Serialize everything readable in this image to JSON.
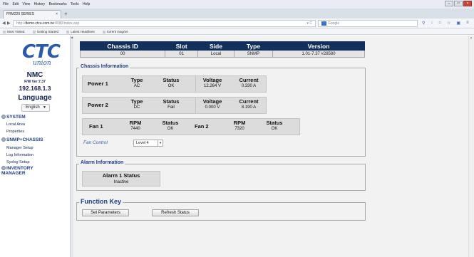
{
  "browser": {
    "menu": [
      "File",
      "Edit",
      "View",
      "History",
      "Bookmarks",
      "Tools",
      "Help"
    ],
    "tab_title": "FRM220 SERIES",
    "tab_close": "×",
    "new_tab": "+",
    "url_host": "demo.ctcu.com.tw",
    "url_path": ":8080/index.asp",
    "url_prefix": "http://",
    "search_placeholder": "Google",
    "bookmarks": [
      "Most Visited",
      "Getting Started",
      "Latest Headlines",
      "torrent magnet"
    ]
  },
  "sidebar": {
    "logo_main": "CTC",
    "logo_sub": "union",
    "product": "NMC",
    "firmware": "F/W Ver:7.37",
    "ip": "192.168.1.3",
    "language_label": "Language",
    "language_value": "English",
    "sections": [
      {
        "title": "SYSTEM",
        "items": [
          "Local Area",
          "Properties"
        ]
      },
      {
        "title": "SNMP+CHASSIS",
        "items": [
          "Manager Setup",
          "Log Information",
          "Syslog Setup"
        ]
      },
      {
        "title": "INVENTORY",
        "title2": "MANAGER",
        "items": []
      }
    ]
  },
  "id_table": {
    "headers": [
      "Chassis ID",
      "Slot",
      "Side",
      "Type",
      "Version"
    ],
    "values": [
      "00",
      "01",
      "Local",
      "SNMP",
      "1.01-7.37 #28580"
    ]
  },
  "chassis_info": {
    "legend": "Chassis Information",
    "power1": {
      "label": "Power 1",
      "h_type": "Type",
      "h_status": "Status",
      "h_voltage": "Voltage",
      "h_current": "Current",
      "type": "AC",
      "status": "OK",
      "voltage": "12.264 V",
      "current": "0.330 A"
    },
    "power2": {
      "label": "Power 2",
      "h_type": "Type",
      "h_status": "Status",
      "h_voltage": "Voltage",
      "h_current": "Current",
      "type": "DC",
      "status": "Fail",
      "voltage": "0.000 V",
      "current": "8.190 A"
    },
    "fan1": {
      "label": "Fan 1",
      "h_rpm": "RPM",
      "h_status": "Status",
      "rpm": "7440",
      "status": "OK"
    },
    "fan2": {
      "label": "Fan 2",
      "h_rpm": "RPM",
      "h_status": "Status",
      "rpm": "7320",
      "status": "OK"
    },
    "fan_control_label": "Fan Control",
    "fan_control_value": "Level 4"
  },
  "alarm_info": {
    "legend": "Alarm Information",
    "title": "Alarm 1 Status",
    "value": "Inactive"
  },
  "function_key": {
    "legend": "Function Key",
    "set_parameters": "Set Parameters",
    "refresh_status": "Refresh Status"
  },
  "colors": {
    "header_navy": "#12305b",
    "accent_blue": "#1f3c82",
    "logo_blue": "#2b5ba8",
    "panel_gray": "#dcdcdc"
  }
}
